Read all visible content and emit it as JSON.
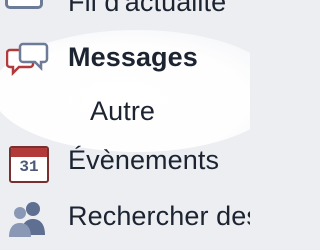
{
  "sidebar": {
    "items": [
      {
        "label": "Fil d'actualité",
        "icon": "news-feed-icon"
      },
      {
        "label": "Messages",
        "icon": "messages-icon",
        "selected": true
      },
      {
        "label": "Autre",
        "icon": ""
      },
      {
        "label": "Évènements",
        "icon": "calendar-icon",
        "icon_text": "31"
      },
      {
        "label": "Rechercher des amis",
        "icon": "find-friends-icon"
      }
    ]
  },
  "colors": {
    "background": "#eceef2",
    "highlight": "#ffffff",
    "text": "#1c2331",
    "icon_blue": "#6d7b96",
    "icon_red": "#b23a3a"
  }
}
